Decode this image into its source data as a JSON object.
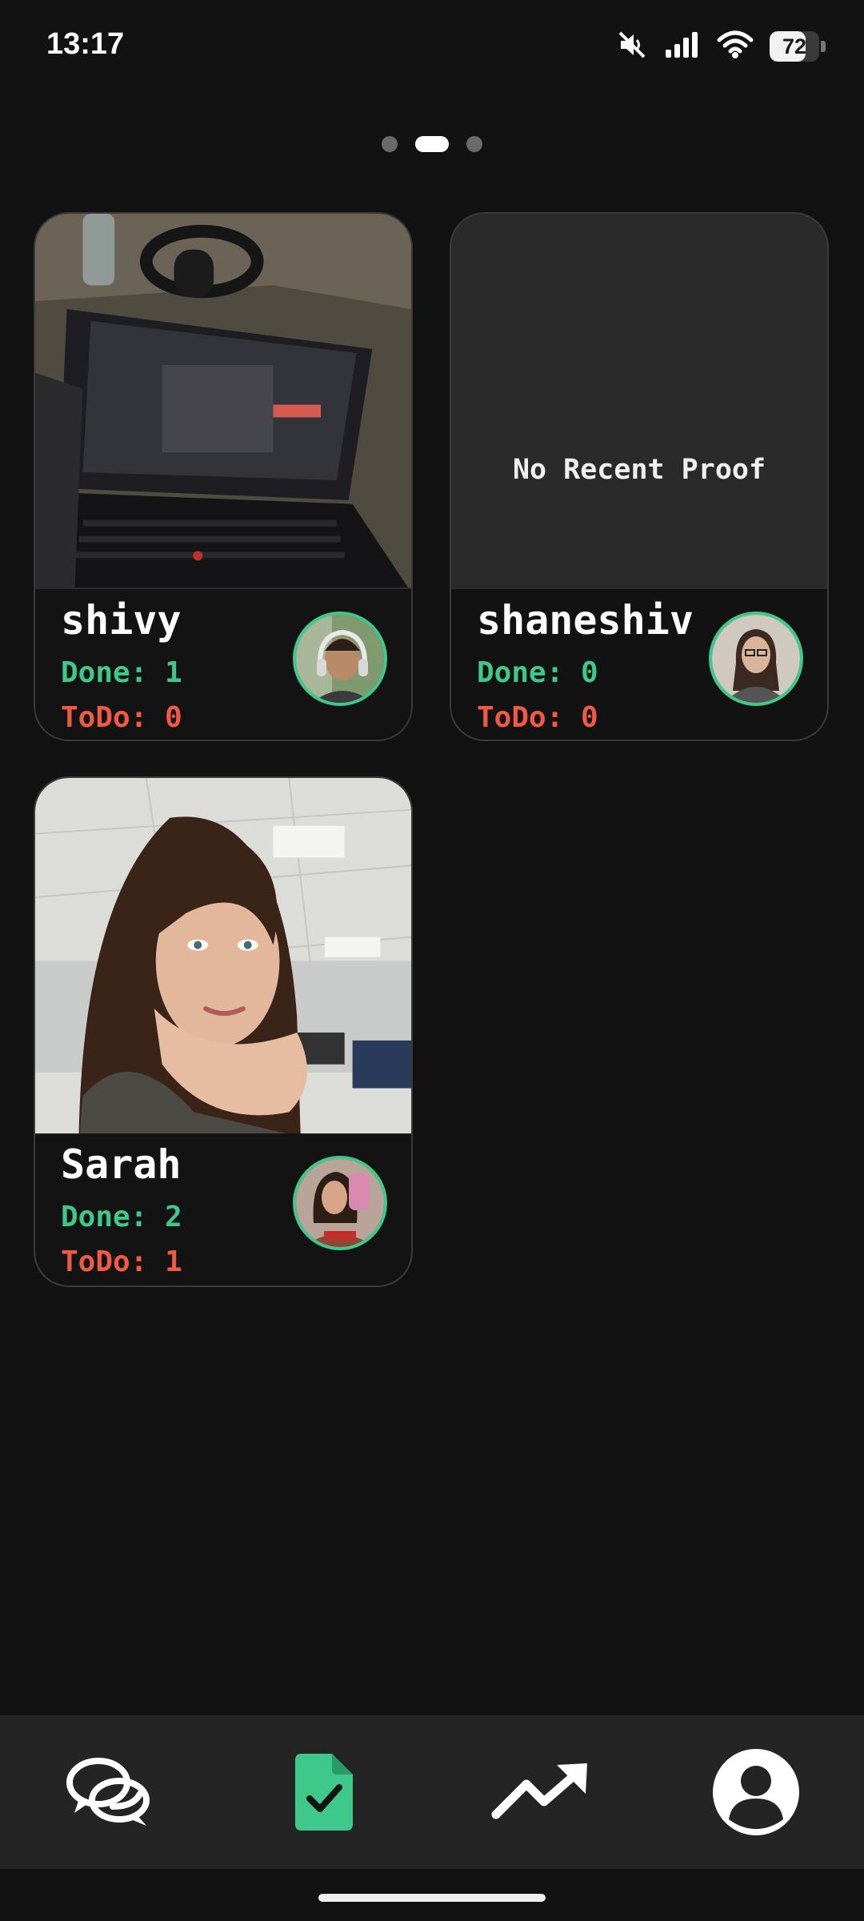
{
  "status_bar": {
    "time": "13:17",
    "battery_percent": "72",
    "battery_level": 0.72,
    "icons": [
      "mute-icon",
      "signal-icon",
      "wifi-icon",
      "battery-icon"
    ]
  },
  "pager": {
    "pages": 3,
    "active_index": 1
  },
  "cards": [
    {
      "name": "shivy",
      "done": "Done: 1",
      "todo": "ToDo: 0",
      "proof": "photo"
    },
    {
      "name": "shaneshiv",
      "done": "Done: 0",
      "todo": "ToDo: 0",
      "no_proof_text": "No Recent Proof"
    },
    {
      "name": "Sarah",
      "done": "Done: 2",
      "todo": "ToDo: 1",
      "proof": "photo"
    }
  ],
  "bottom_nav": {
    "items": [
      "chat-icon",
      "proof-document-icon",
      "trending-icon",
      "profile-icon"
    ],
    "active": "proof-document-icon"
  },
  "colors": {
    "accent_green": "#3ec98b",
    "todo_red": "#ef5a45",
    "background": "#121212",
    "card": "#2a2a2a",
    "nav_bar": "#242424"
  }
}
